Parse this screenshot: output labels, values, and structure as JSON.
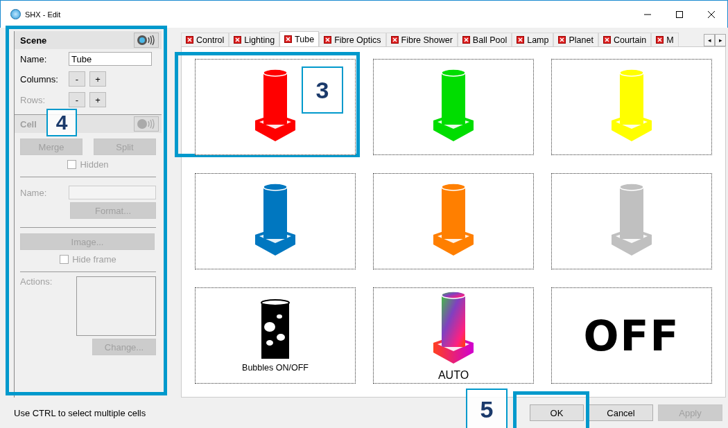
{
  "window": {
    "title": "SHX - Edit"
  },
  "scene": {
    "title": "Scene",
    "name_label": "Name:",
    "name_value": "Tube",
    "columns_label": "Columns:",
    "rows_label": "Rows:",
    "minus": "-",
    "plus": "+",
    "callout": "4"
  },
  "cell": {
    "title": "Cell",
    "disabled": true,
    "merge": "Merge",
    "split": "Split",
    "hidden_label": "Hidden",
    "hidden_checked": false,
    "name_label": "Name:",
    "format": "Format...",
    "image": "Image...",
    "hide_frame_label": "Hide frame",
    "hide_frame_checked": false,
    "actions_label": "Actions:",
    "change": "Change..."
  },
  "tabs": [
    {
      "label": "Control",
      "selected": false
    },
    {
      "label": "Lighting",
      "selected": false
    },
    {
      "label": "Tube",
      "selected": true
    },
    {
      "label": "Fibre Optics",
      "selected": false
    },
    {
      "label": "Fibre Shower",
      "selected": false
    },
    {
      "label": "Ball Pool",
      "selected": false
    },
    {
      "label": "Lamp",
      "selected": false
    },
    {
      "label": "Planet",
      "selected": false
    },
    {
      "label": "Courtain",
      "selected": false
    },
    {
      "label": "M",
      "selected": false
    }
  ],
  "tab_scroll": [
    "◂",
    "▸"
  ],
  "cells": [
    {
      "kind": "tube",
      "color": "#ff0000",
      "callout": "3"
    },
    {
      "kind": "tube",
      "color": "#00dd00"
    },
    {
      "kind": "tube",
      "color": "#ffff00"
    },
    {
      "kind": "tube",
      "color": "#0077c0"
    },
    {
      "kind": "tube",
      "color": "#ff7f00"
    },
    {
      "kind": "tube",
      "color": "#c0c0c0"
    },
    {
      "kind": "bubbles",
      "label": "Bubbles ON/OFF"
    },
    {
      "kind": "auto",
      "label": "AUTO"
    },
    {
      "kind": "off",
      "label": "OFF"
    }
  ],
  "status_bar": {
    "text": "Use CTRL to select multiple cells"
  },
  "buttons": [
    {
      "label": "OK",
      "disabled": false,
      "callout": "5"
    },
    {
      "label": "Cancel",
      "disabled": false
    },
    {
      "label": "Apply",
      "disabled": true
    }
  ]
}
